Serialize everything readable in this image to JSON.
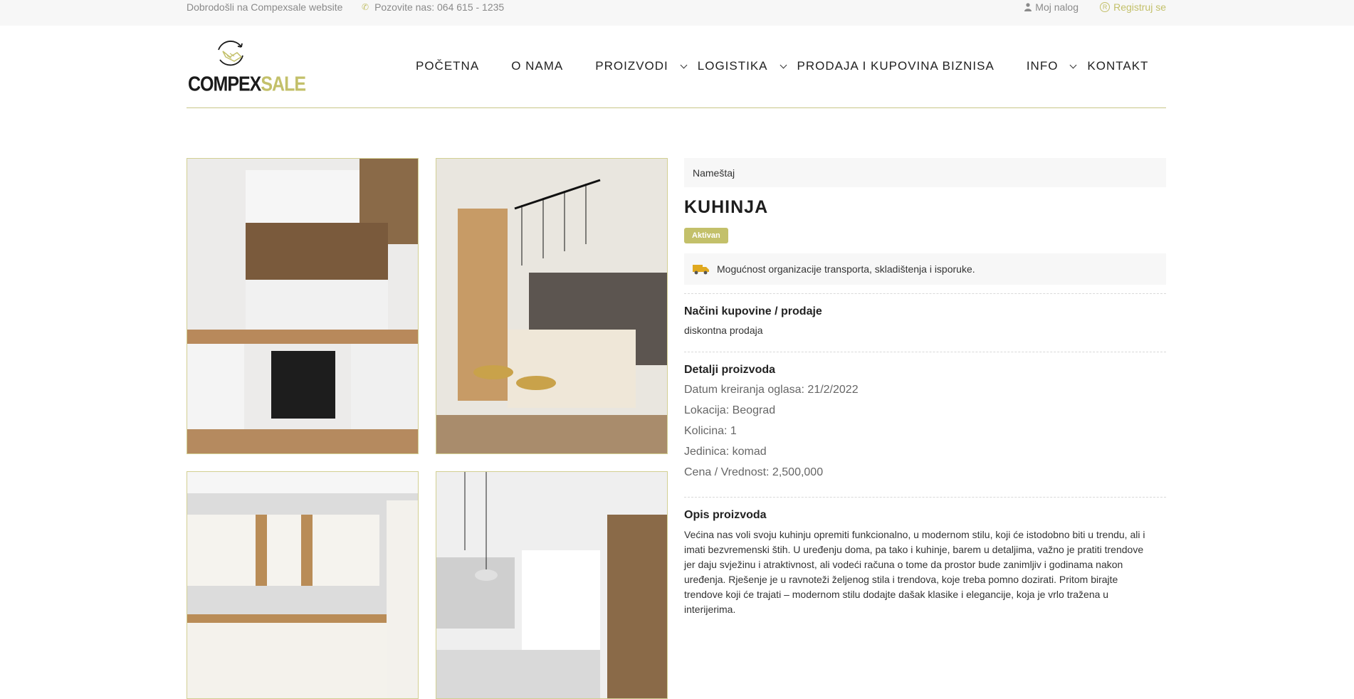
{
  "topbar": {
    "welcome": "Dobrodošli na Compexsale website",
    "phone": "Pozovite nas: 064 615 - 1235",
    "account": "Moj nalog",
    "register": "Registruj se"
  },
  "logo": {
    "part1": "COMPEX",
    "part2": "SALE"
  },
  "nav": {
    "items": [
      {
        "label": "POČETNA",
        "dropdown": false
      },
      {
        "label": "O NAMA",
        "dropdown": false
      },
      {
        "label": "PROIZVODI",
        "dropdown": true
      },
      {
        "label": "LOGISTIKA",
        "dropdown": true
      },
      {
        "label": "PRODAJA I KUPOVINA BIZNISA",
        "dropdown": false
      },
      {
        "label": "INFO",
        "dropdown": true
      },
      {
        "label": "KONTAKT",
        "dropdown": false
      }
    ]
  },
  "product": {
    "category": "Nameštaj",
    "title": "KUHINJA",
    "status": "Aktivan",
    "transport_note": "Mogućnost organizacije transporta, skladištenja i isporuke.",
    "purchase_title": "Načini kupovine / prodaje",
    "purchase_value": "diskontna prodaja",
    "details_title": "Detalji proizvoda",
    "details": [
      "Datum kreiranja oglasa: 21/2/2022",
      "Lokacija: Beograd",
      "Kolicina: 1",
      "Jedinica: komad",
      "Cena / Vrednost: 2,500,000"
    ],
    "description_title": "Opis proizvoda",
    "description": "Većina nas voli svoju kuhinju opremiti funkcionalno, u modernom stilu, koji će istodobno biti u trendu, ali i imati bezvremenski štih. U uređenju doma, pa tako i kuhinje, barem u detaljima, važno je pratiti trendove jer daju svježinu i atraktivnost, ali vodeći računa o tome da prostor bude zanimljiv i godinama nakon uređenja. Rješenje je u ravnoteži željenog stila i trendova, koje treba pomno dozirati. Pritom birajte trendove koji će trajati – modernom stilu dodajte dašak klasike i elegancije, koja je vrlo tražena u interijerima."
  },
  "colors": {
    "accent": "#c3c06a",
    "topbar_bg": "#f7f7f7",
    "text": "#333333"
  }
}
